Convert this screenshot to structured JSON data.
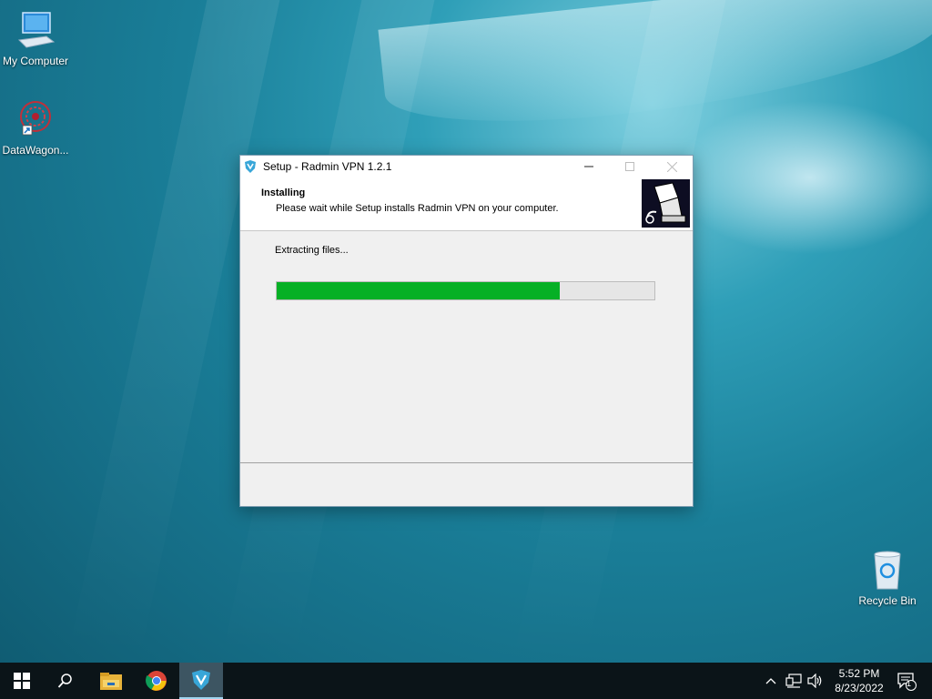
{
  "desktop": {
    "icons": [
      {
        "label": "My Computer",
        "icon": "computer-icon"
      },
      {
        "label": "DataWagon...",
        "icon": "datawagon-icon"
      },
      {
        "label": "Recycle Bin",
        "icon": "recycle-bin-icon"
      }
    ]
  },
  "window": {
    "title": "Setup - Radmin VPN 1.2.1",
    "app_icon": "radmin-vpn-icon",
    "header_title": "Installing",
    "header_subtitle": "Please wait while Setup installs Radmin VPN on your computer.",
    "status_text": "Extracting files...",
    "progress": 0.75,
    "progress_color": "#06b025"
  },
  "taskbar": {
    "items": [
      {
        "icon": "windows-start-icon"
      },
      {
        "icon": "search-icon"
      },
      {
        "icon": "file-explorer-icon"
      },
      {
        "icon": "chrome-icon"
      },
      {
        "icon": "radmin-vpn-icon",
        "active": true
      }
    ],
    "tray": {
      "icons": [
        "chevron-up-icon",
        "network-icon",
        "volume-icon"
      ],
      "time": "5:52 PM",
      "date": "8/23/2022",
      "notifications_count": "1"
    }
  }
}
